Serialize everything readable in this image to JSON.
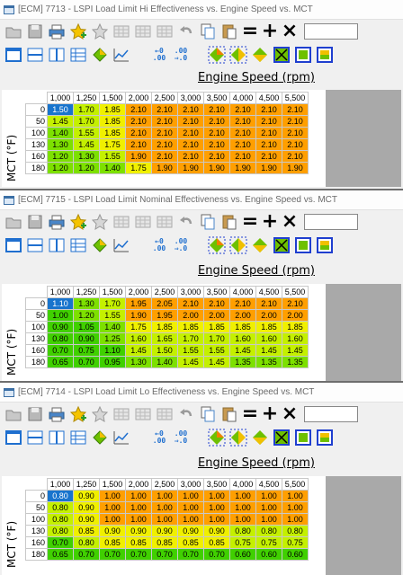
{
  "colors": {
    "selected": "#1874cd",
    "orange": "#ff9f00",
    "yellow": "#f0f000",
    "yellow_green": "#c4f000",
    "green": "#7de000",
    "green_dark": "#40d000"
  },
  "icons": [
    "folder-icon",
    "save-icon",
    "print-icon",
    "star-add-icon",
    "star-remove-icon",
    "table-icon",
    "table-icon-2",
    "table-icon-3",
    "undo-icon",
    "copy-icon",
    "paste-icon",
    "equals-icon",
    "plus-icon",
    "multiply-icon"
  ],
  "windows": [
    {
      "title": "[ECM] 7713 - LSPI Load Limit Hi Effectiveness vs. Engine Speed vs. MCT",
      "x_axis_label": "Engine Speed (rpm)",
      "y_axis_label": "MCT (°F)",
      "columns": [
        "1,000",
        "1,250",
        "1,500",
        "2,000",
        "2,500",
        "3,000",
        "3,500",
        "4,000",
        "4,500",
        "5,500"
      ],
      "rows": [
        {
          "label": "0",
          "values": [
            "1.50",
            "1.70",
            "1.85",
            "2.10",
            "2.10",
            "2.10",
            "2.10",
            "2.10",
            "2.10",
            "2.10"
          ]
        },
        {
          "label": "50",
          "values": [
            "1.45",
            "1.70",
            "1.85",
            "2.10",
            "2.10",
            "2.10",
            "2.10",
            "2.10",
            "2.10",
            "2.10"
          ]
        },
        {
          "label": "100",
          "values": [
            "1.40",
            "1.55",
            "1.85",
            "2.10",
            "2.10",
            "2.10",
            "2.10",
            "2.10",
            "2.10",
            "2.10"
          ]
        },
        {
          "label": "130",
          "values": [
            "1.30",
            "1.45",
            "1.75",
            "2.10",
            "2.10",
            "2.10",
            "2.10",
            "2.10",
            "2.10",
            "2.10"
          ]
        },
        {
          "label": "160",
          "values": [
            "1.20",
            "1.30",
            "1.55",
            "1.90",
            "2.10",
            "2.10",
            "2.10",
            "2.10",
            "2.10",
            "2.10"
          ]
        },
        {
          "label": "180",
          "values": [
            "1.20",
            "1.20",
            "1.40",
            "1.75",
            "1.90",
            "1.90",
            "1.90",
            "1.90",
            "1.90",
            "1.90"
          ]
        }
      ]
    },
    {
      "title": "[ECM] 7715 - LSPI Load Limit Nominal Effectiveness vs. Engine Speed vs. MCT",
      "x_axis_label": "Engine Speed (rpm)",
      "y_axis_label": "MCT (°F)",
      "columns": [
        "1,000",
        "1,250",
        "1,500",
        "2,000",
        "2,500",
        "3,000",
        "3,500",
        "4,000",
        "4,500",
        "5,500"
      ],
      "rows": [
        {
          "label": "0",
          "values": [
            "1.10",
            "1.30",
            "1.70",
            "1.95",
            "2.05",
            "2.10",
            "2.10",
            "2.10",
            "2.10",
            "2.10"
          ]
        },
        {
          "label": "50",
          "values": [
            "1.00",
            "1.20",
            "1.55",
            "1.90",
            "1.95",
            "2.00",
            "2.00",
            "2.00",
            "2.00",
            "2.00"
          ]
        },
        {
          "label": "100",
          "values": [
            "0.90",
            "1.05",
            "1.40",
            "1.75",
            "1.85",
            "1.85",
            "1.85",
            "1.85",
            "1.85",
            "1.85"
          ]
        },
        {
          "label": "130",
          "values": [
            "0.80",
            "0.90",
            "1.25",
            "1.60",
            "1.65",
            "1.70",
            "1.70",
            "1.60",
            "1.60",
            "1.60"
          ]
        },
        {
          "label": "160",
          "values": [
            "0.70",
            "0.75",
            "1.10",
            "1.45",
            "1.50",
            "1.55",
            "1.55",
            "1.45",
            "1.45",
            "1.45"
          ]
        },
        {
          "label": "180",
          "values": [
            "0.65",
            "0.70",
            "0.95",
            "1.30",
            "1.40",
            "1.45",
            "1.45",
            "1.35",
            "1.35",
            "1.35"
          ]
        }
      ]
    },
    {
      "title": "[ECM] 7714 - LSPI Load Limit Lo Effectiveness vs. Engine Speed vs. MCT",
      "x_axis_label": "Engine Speed (rpm)",
      "y_axis_label": "MCT (°F)",
      "columns": [
        "1,000",
        "1,250",
        "1,500",
        "2,000",
        "2,500",
        "3,000",
        "3,500",
        "4,000",
        "4,500",
        "5,500"
      ],
      "rows": [
        {
          "label": "0",
          "values": [
            "0.80",
            "0.90",
            "1.00",
            "1.00",
            "1.00",
            "1.00",
            "1.00",
            "1.00",
            "1.00",
            "1.00"
          ]
        },
        {
          "label": "50",
          "values": [
            "0.80",
            "0.90",
            "1.00",
            "1.00",
            "1.00",
            "1.00",
            "1.00",
            "1.00",
            "1.00",
            "1.00"
          ]
        },
        {
          "label": "100",
          "values": [
            "0.80",
            "0.90",
            "1.00",
            "1.00",
            "1.00",
            "1.00",
            "1.00",
            "1.00",
            "1.00",
            "1.00"
          ]
        },
        {
          "label": "130",
          "values": [
            "0.80",
            "0.85",
            "0.90",
            "0.90",
            "0.90",
            "0.90",
            "0.90",
            "0.80",
            "0.80",
            "0.80"
          ]
        },
        {
          "label": "160",
          "values": [
            "0.70",
            "0.80",
            "0.85",
            "0.85",
            "0.85",
            "0.85",
            "0.85",
            "0.75",
            "0.75",
            "0.75"
          ]
        },
        {
          "label": "180",
          "values": [
            "0.65",
            "0.70",
            "0.70",
            "0.70",
            "0.70",
            "0.70",
            "0.70",
            "0.60",
            "0.60",
            "0.60"
          ]
        }
      ]
    }
  ]
}
